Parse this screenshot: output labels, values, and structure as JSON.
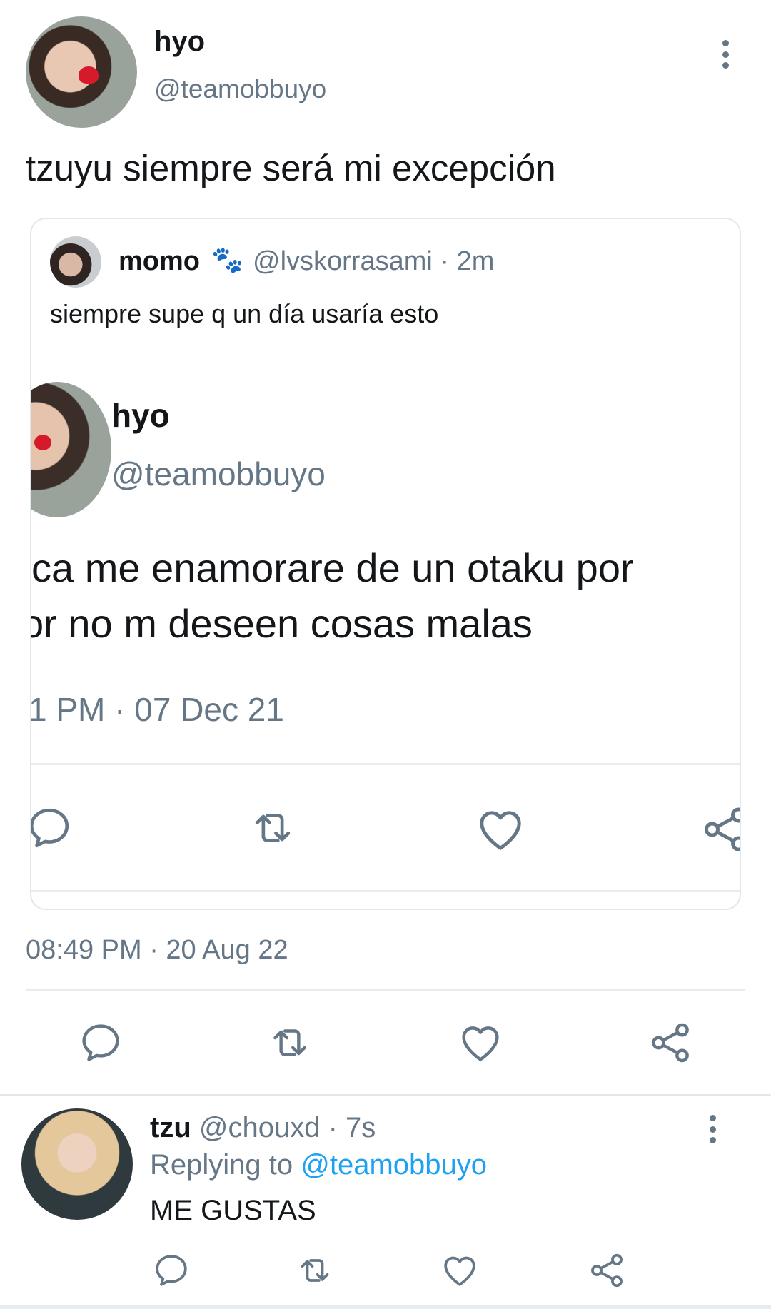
{
  "tweet": {
    "author_name": "hyo",
    "author_handle": "@teamobbuyo",
    "text": "tzuyu siempre será mi excepción",
    "timestamp": "08:49 PM · 20 Aug 22",
    "quoted": {
      "author_name": "momo",
      "author_emoji": "🐾",
      "author_handle_time": "@lvskorrasami · 2m",
      "text": "siempre supe q un día usaría esto",
      "screenshot": {
        "author_name": "hyo",
        "author_handle": "@teamobbuyo",
        "line1": "ca me enamorare de un otaku por",
        "line2": "or no m deseen cosas malas",
        "timestamp": "1 PM · 07 Dec 21"
      }
    }
  },
  "reply": {
    "author_name": "tzu",
    "meta": "@chouxd · 7s",
    "replying_prefix": "Replying to",
    "replying_handle": "@teamobbuyo",
    "text": "ME GUSTAS"
  },
  "icons": {
    "reply": "comment-icon",
    "retweet": "retweet-icon",
    "like": "heart-icon",
    "share": "share-icon",
    "more": "more-vertical-icon"
  },
  "colors": {
    "text": "#14171a",
    "secondary": "#657786",
    "link": "#1da1f2",
    "divider": "#e6ecf0"
  }
}
